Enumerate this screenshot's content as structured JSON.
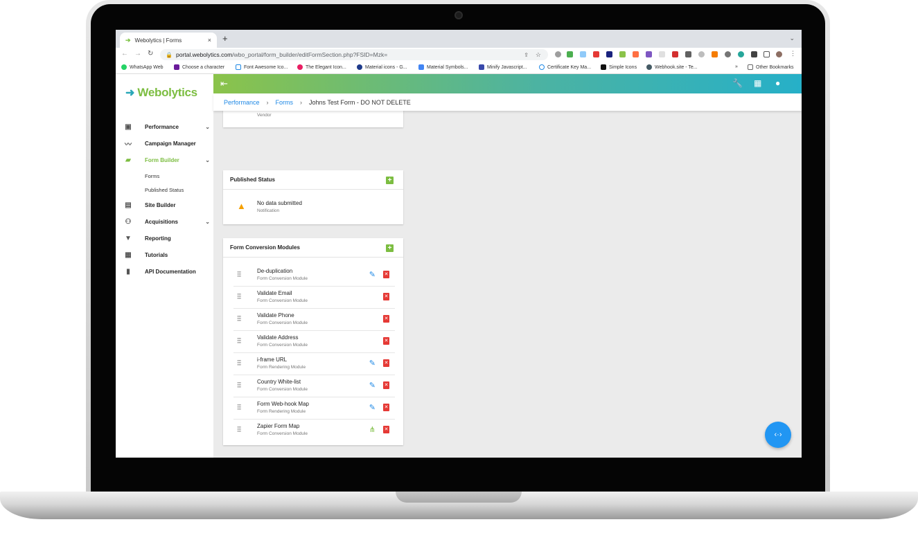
{
  "browser": {
    "tab_title": "Webolytics | Forms",
    "tab_close": "×",
    "new_tab": "+",
    "url_domain": "portal.webolytics.com",
    "url_path": "/wbo_portal/form_builder/editFormSection.php?FSID=Mzk=",
    "bookmarks": [
      "WhatsApp Web",
      "Choose a character",
      "Font Awesome Ico...",
      "The Elegant Icon...",
      "Material icons - G...",
      "Material Symbols...",
      "Minify Javascript...",
      "Certificate Key Ma...",
      "Simple Icons",
      "Webhook.site - Te..."
    ],
    "bookmarks_overflow": "»",
    "other_bookmarks": "Other Bookmarks"
  },
  "app": {
    "logo_text": "Webolytics",
    "nav": [
      {
        "label": "Performance",
        "icon": "dashboard-icon"
      },
      {
        "label": "Campaign Manager",
        "icon": "trend-icon"
      },
      {
        "label": "Form Builder",
        "icon": "form-edit-icon"
      },
      {
        "label": "Site Builder",
        "icon": "browser-icon"
      },
      {
        "label": "Acquisitions",
        "icon": "people-icon"
      },
      {
        "label": "Reporting",
        "icon": "download-box-icon"
      },
      {
        "label": "Tutorials",
        "icon": "video-library-icon"
      },
      {
        "label": "API Documentation",
        "icon": "book-icon"
      }
    ],
    "form_builder_sub": [
      "Forms",
      "Published Status"
    ],
    "breadcrumb": [
      "Performance",
      "Forms",
      "Johns Test Form - DO NOT DELETE"
    ],
    "vendor_row_sub": "Vendor",
    "published_status": {
      "title": "Published Status",
      "item_title": "No data submitted",
      "item_sub": "Notification"
    },
    "modules": {
      "title": "Form Conversion Modules",
      "rows": [
        {
          "name": "De-duplication",
          "type": "Form Conversion Module",
          "action": "edit"
        },
        {
          "name": "Validate Email",
          "type": "Form Conversion Module",
          "action": "none"
        },
        {
          "name": "Validate Phone",
          "type": "Form Conversion Module",
          "action": "none"
        },
        {
          "name": "Validate Address",
          "type": "Form Conversion Module",
          "action": "none"
        },
        {
          "name": "i-frame URL",
          "type": "Form Rendering Module",
          "action": "edit"
        },
        {
          "name": "Country White-list",
          "type": "Form Conversion Module",
          "action": "edit"
        },
        {
          "name": "Form Web-hook Map",
          "type": "Form Rendering Module",
          "action": "edit"
        },
        {
          "name": "Zapier Form Map",
          "type": "Form Conversion Module",
          "action": "zapier"
        }
      ]
    }
  },
  "colors": {
    "brand_green": "#7cbd41",
    "brand_teal": "#26b0c8",
    "link_blue": "#1e88e5",
    "delete_red": "#e53935",
    "warning_orange": "#f5a000",
    "fab_blue": "#2196f3"
  }
}
